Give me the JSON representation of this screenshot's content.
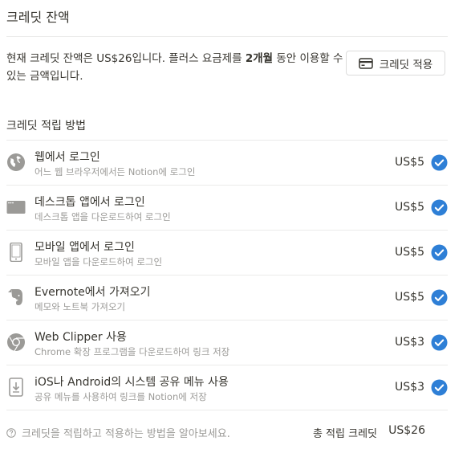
{
  "header": {
    "title": "크레딧 잔액"
  },
  "balance": {
    "prefix": "현재 크레딧 잔액은 ",
    "amount": "US$26",
    "middle": "입니다. 플러스 요금제를 ",
    "months": "2개월",
    "suffix": " 동안 이용할 수 있는 금액입니다."
  },
  "apply_button": {
    "label": "크레딧 적용",
    "icon": "credit-card-icon"
  },
  "methods": {
    "title": "크레딧 적립 방법",
    "items": [
      {
        "name": "웹에서 로그인",
        "desc": "어느 웹 브라우저에서든 Notion에 로그인",
        "amount": "US$5",
        "icon": "globe-icon",
        "completed": true
      },
      {
        "name": "데스크톱 앱에서 로그인",
        "desc": "데스크톱 앱을 다운로드하여 로그인",
        "amount": "US$5",
        "icon": "desktop-app-icon",
        "completed": true
      },
      {
        "name": "모바일 앱에서 로그인",
        "desc": "모바일 앱을 다운로드하여 로그인",
        "amount": "US$5",
        "icon": "mobile-phone-icon",
        "completed": true
      },
      {
        "name": "Evernote에서 가져오기",
        "desc": "메모와 노트북 가져오기",
        "amount": "US$5",
        "icon": "evernote-icon",
        "completed": true
      },
      {
        "name": "Web Clipper 사용",
        "desc": "Chrome 확장 프로그램을 다운로드하여 링크 저장",
        "amount": "US$3",
        "icon": "chrome-icon",
        "completed": true
      },
      {
        "name": "iOS나 Android의 시스템 공유 메뉴 사용",
        "desc": "공유 메뉴를 사용하여 링크를 Notion에 저장",
        "amount": "US$3",
        "icon": "share-icon",
        "completed": true
      }
    ]
  },
  "footer": {
    "help": "크레딧을 적립하고 적용하는 방법을 알아보세요.",
    "total_label": "총 적립 크레딧",
    "total_value": "US$26"
  },
  "colors": {
    "accent": "#2e7fd6",
    "text": "#37352f",
    "muted": "#9b9a97",
    "icon": "#9b9a97",
    "border": "#ebebea"
  }
}
